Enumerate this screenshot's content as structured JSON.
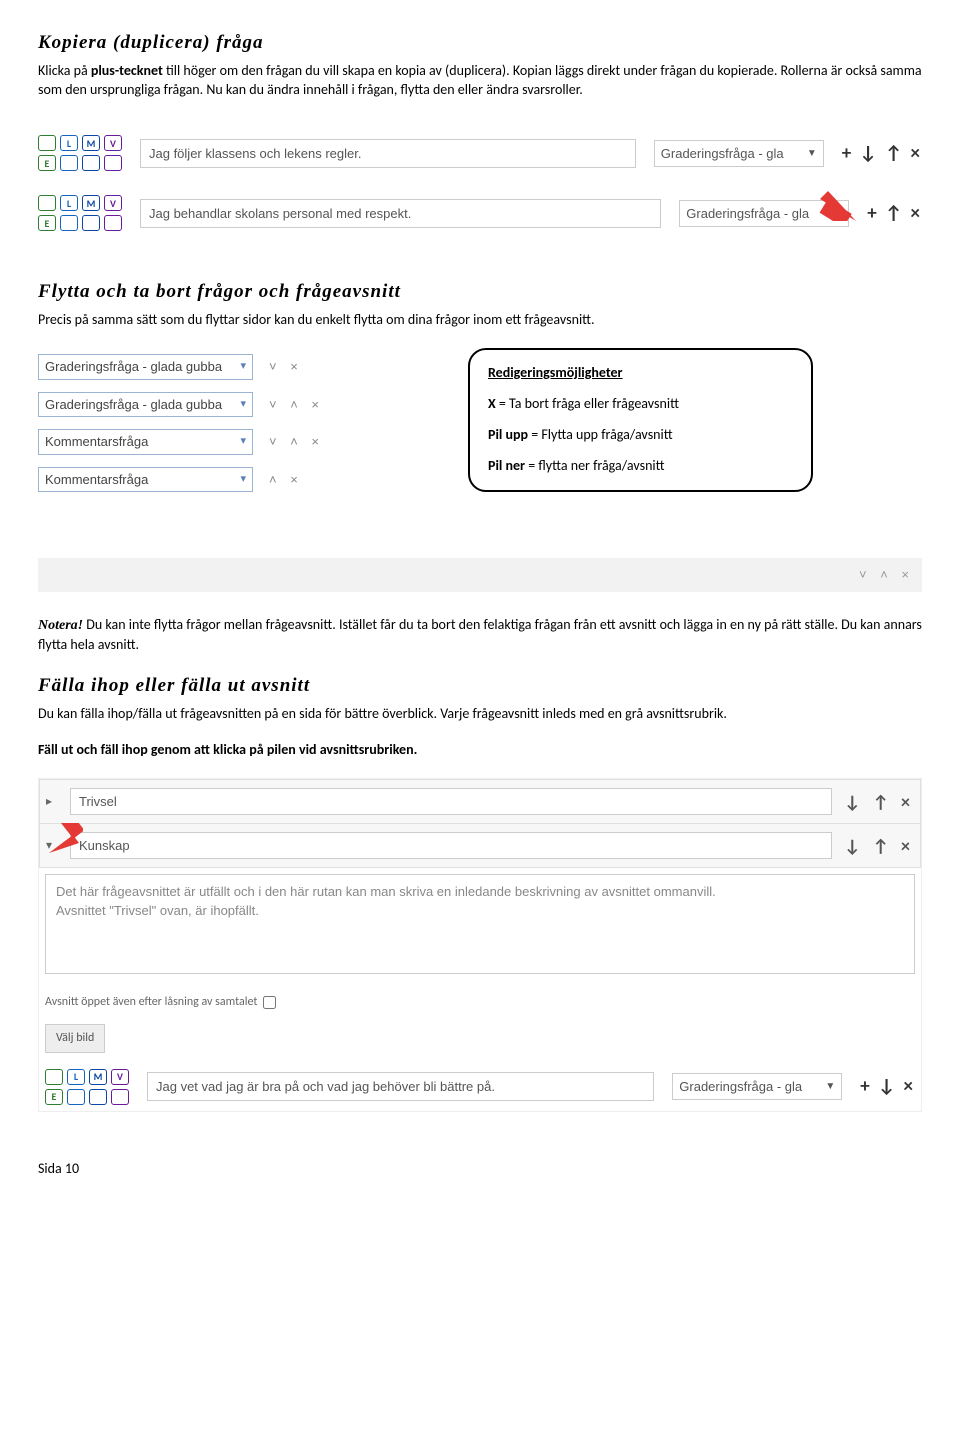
{
  "h_copy": "Kopiera (duplicera) fråga",
  "p_copy1a": "Klicka på ",
  "p_copy1b": "plus-tecknet",
  "p_copy1c": " till höger om den frågan du vill skapa en kopia av (duplicera). Kopian läggs direkt under frågan du kopierade. Rollerna är också samma som den ursprungliga frågan. Nu kan du ändra innehåll i frågan, flytta den eller ändra svarsroller.",
  "tag_E": "E",
  "tag_L": "L",
  "tag_M": "M",
  "tag_V": "V",
  "q1_text": "Jag följer klassens och lekens regler.",
  "q2_text": "Jag behandlar skolans personal med respekt.",
  "sel_grad": "Graderingsfråga - gla",
  "icons_row1": "+ ↓ ↑ ×",
  "icons_row2": "+ ↑ ×",
  "h_move": "Flytta och ta bort frågor och frågeavsnitt",
  "p_move": "Precis på samma sätt som du flyttar sidor kan du enkelt flytta om dina frågor inom ett frågeavsnitt.",
  "d1": "Graderingsfråga - glada gubba",
  "d2": "Graderingsfråga - glada gubba",
  "d3": "Kommentarsfråga",
  "d4": "Kommentarsfråga",
  "dc1": "˅     ×",
  "dc2": "˅  ˄  ×",
  "dc3": "˅  ˄  ×",
  "dc4": "˄  ×",
  "dc5": "˅  ˄  ×",
  "call_h": "Redigeringsmöjligheter",
  "call_x": "X",
  "call_x2": " = Ta bort fråga eller frågeavsnitt",
  "call_up1": "Pil upp",
  "call_up2": " = Flytta upp fråga/avsnitt",
  "call_dn1": "Pil ner",
  "call_dn2": " = flytta ner fråga/avsnitt",
  "notera": "Notera!",
  "p_notera": " Du kan inte flytta frågor mellan frågeavsnitt. Istället får du ta bort den felaktiga frågan från ett avsnitt och lägga in en ny på rätt ställe. Du kan annars flytta hela avsnitt.",
  "h_fold": "Fälla ihop eller fälla ut avsnitt",
  "p_fold": "Du kan fälla ihop/fälla ut frågeavsnitten på en sida för bättre överblick. Varje frågeavsnitt inleds med en grå avsnittsrubrik.",
  "p_fold_bold": "Fäll ut och fäll ihop genom att klicka på pilen vid avsnittsrubriken.",
  "sec1": "Trivsel",
  "sec2": "Kunskap",
  "sec_ctrl": "↓  ↑  ×",
  "desc_text": "Det här frågeavsnittet är utfällt och i den här rutan kan man skriva en inledande beskrivning av avsnittet ommanvill.\nAvsnittet \"Trivsel\" ovan, är ihopfällt.",
  "lock_label": "Avsnitt öppet även efter låsning av samtalet",
  "imgbtn": "Välj bild",
  "q_bottom": "Jag vet vad jag är bra på och vad jag behöver bli bättre på.",
  "icons_bottom": "+ ↓ ×",
  "footer": "Sida 10"
}
